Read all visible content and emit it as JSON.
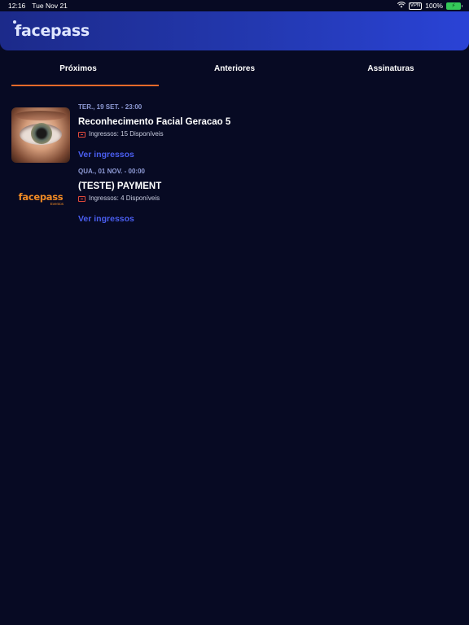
{
  "status_bar": {
    "time": "12:16",
    "date": "Tue Nov 21",
    "vpn": "VPN",
    "battery": "100%"
  },
  "header": {
    "logo": "facepass"
  },
  "tabs": [
    {
      "label": "Próximos",
      "active": true
    },
    {
      "label": "Anteriores",
      "active": false
    },
    {
      "label": "Assinaturas",
      "active": false
    }
  ],
  "events": [
    {
      "date": "TER., 19 SET. - 23:00",
      "title": "Reconhecimento Facial Geracao 5",
      "tickets": "Ingressos: 15 Disponíveis",
      "link": "Ver ingressos",
      "thumbnail": "eye-photo"
    },
    {
      "date": "QUA., 01 NOV. - 00:00",
      "title": "(TESTE) PAYMENT",
      "tickets": "Ingressos: 4 Disponíveis",
      "link": "Ver ingressos",
      "thumbnail": "facepass-logo",
      "logo_text": "facepass",
      "logo_sub": "Eventos"
    }
  ],
  "colors": {
    "background": "#070a23",
    "accent": "#e76a2a",
    "link": "#4a5ef0",
    "date": "#8f9bd6"
  }
}
